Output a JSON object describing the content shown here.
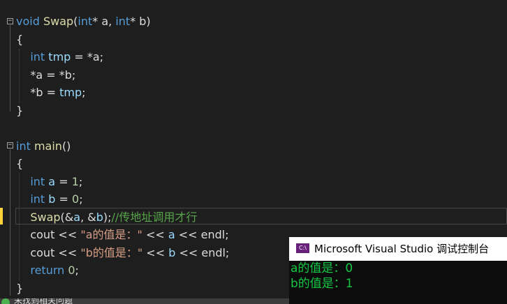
{
  "code_lines": [
    {
      "parts": [
        {
          "t": "void",
          "c": "kw"
        },
        {
          "t": " "
        },
        {
          "t": "Swap",
          "c": "fn"
        },
        {
          "t": "("
        },
        {
          "t": "int",
          "c": "kw"
        },
        {
          "t": "* a, "
        },
        {
          "t": "int",
          "c": "kw"
        },
        {
          "t": "* b)"
        }
      ]
    },
    {
      "parts": [
        {
          "t": "{"
        }
      ]
    },
    {
      "parts": [
        {
          "t": "    "
        },
        {
          "t": "int",
          "c": "kw"
        },
        {
          "t": " "
        },
        {
          "t": "tmp",
          "c": "var"
        },
        {
          "t": " = *a;"
        }
      ]
    },
    {
      "parts": [
        {
          "t": "    *a = *b;"
        }
      ]
    },
    {
      "parts": [
        {
          "t": "    *b = "
        },
        {
          "t": "tmp",
          "c": "var"
        },
        {
          "t": ";"
        }
      ]
    },
    {
      "parts": [
        {
          "t": "}"
        }
      ]
    },
    {
      "parts": []
    },
    {
      "parts": [
        {
          "t": "int",
          "c": "kw"
        },
        {
          "t": " "
        },
        {
          "t": "main",
          "c": "fn"
        },
        {
          "t": "()"
        }
      ]
    },
    {
      "parts": [
        {
          "t": "{"
        }
      ]
    },
    {
      "parts": [
        {
          "t": "    "
        },
        {
          "t": "int",
          "c": "kw"
        },
        {
          "t": " "
        },
        {
          "t": "a",
          "c": "var"
        },
        {
          "t": " = "
        },
        {
          "t": "1",
          "c": "num"
        },
        {
          "t": ";"
        }
      ]
    },
    {
      "parts": [
        {
          "t": "    "
        },
        {
          "t": "int",
          "c": "kw"
        },
        {
          "t": " "
        },
        {
          "t": "b",
          "c": "var"
        },
        {
          "t": " = "
        },
        {
          "t": "0",
          "c": "num"
        },
        {
          "t": ";"
        }
      ]
    },
    {
      "parts": [
        {
          "t": "    "
        },
        {
          "t": "Swap",
          "c": "fn"
        },
        {
          "t": "(&"
        },
        {
          "t": "a",
          "c": "var"
        },
        {
          "t": ", &"
        },
        {
          "t": "b",
          "c": "var"
        },
        {
          "t": ");"
        },
        {
          "t": "//传地址调用才行",
          "c": "cmt"
        }
      ]
    },
    {
      "parts": [
        {
          "t": "    cout << "
        },
        {
          "t": "\"a的值是：\"",
          "c": "str"
        },
        {
          "t": " << "
        },
        {
          "t": "a",
          "c": "var"
        },
        {
          "t": " << endl;"
        }
      ]
    },
    {
      "parts": [
        {
          "t": "    cout << "
        },
        {
          "t": "\"b的值是：\"",
          "c": "str"
        },
        {
          "t": " << "
        },
        {
          "t": "b",
          "c": "var"
        },
        {
          "t": " << endl;"
        }
      ]
    },
    {
      "parts": [
        {
          "t": "    "
        },
        {
          "t": "return",
          "c": "kw"
        },
        {
          "t": " "
        },
        {
          "t": "0",
          "c": "num"
        },
        {
          "t": ";"
        }
      ]
    },
    {
      "parts": [
        {
          "t": "}"
        }
      ]
    }
  ],
  "fold_toggles": [
    "⊟",
    "⊟"
  ],
  "console": {
    "icon_label": "C:\\",
    "title": "Microsoft Visual Studio 调试控制台",
    "output": [
      "a的值是：0",
      "b的值是：1"
    ]
  },
  "status_bar": {
    "text": "未找到相关问题"
  }
}
